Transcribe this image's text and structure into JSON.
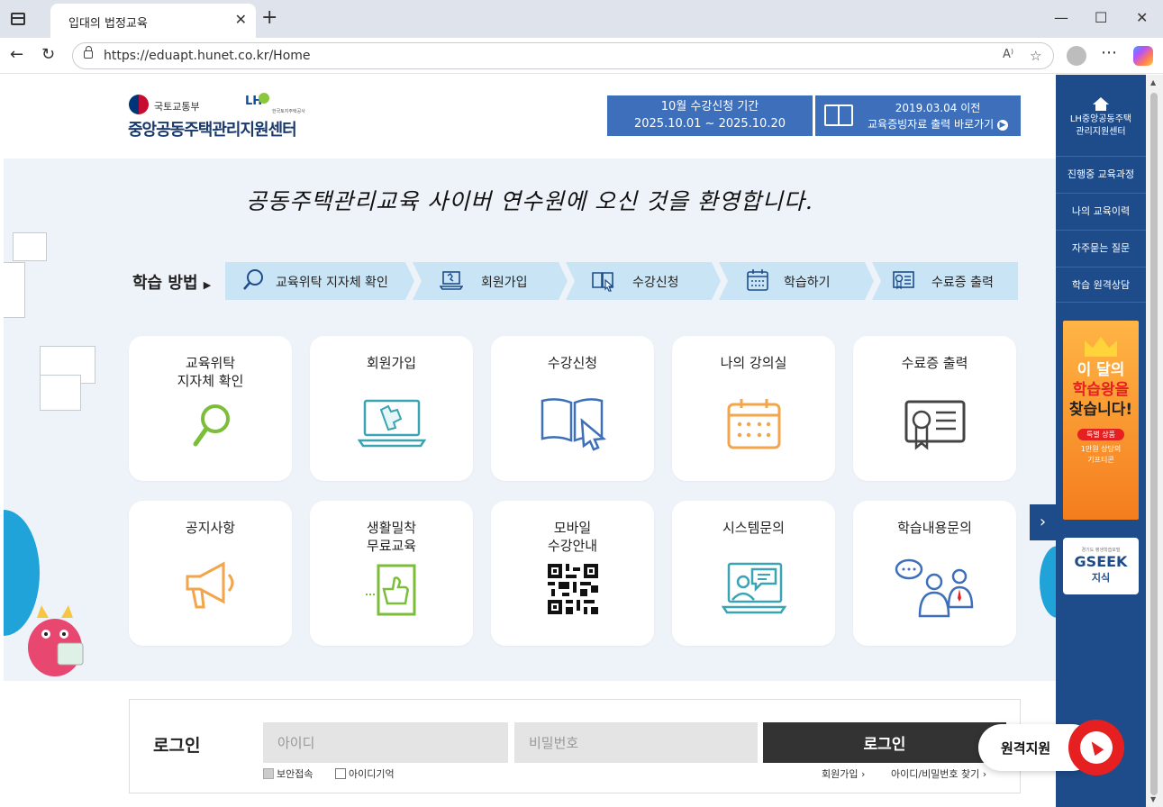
{
  "browser": {
    "tab_title": "입대의 법정교육",
    "url": "https://eduapt.hunet.co.kr/Home"
  },
  "header": {
    "ministry": "국토교통부",
    "lh_logo": "LH",
    "lh_sub": "한국토지주택공사",
    "site_name": "중앙공동주택관리지원센터",
    "banner1_line1": "10월 수강신청 기간",
    "banner1_line2": "2025.10.01 ~ 2025.10.20",
    "banner2_line1": "2019.03.04 이전",
    "banner2_line2": "교육증빙자료 출력 바로가기"
  },
  "hero": {
    "welcome": "공동주택관리교육 사이버 연수원에 오신 것을 환영합니다."
  },
  "steps": {
    "label": "학습 방법",
    "items": [
      {
        "label": "교육위탁 지자체 확인",
        "icon": "search-icon"
      },
      {
        "label": "회원가입",
        "icon": "laptop-puzzle-icon"
      },
      {
        "label": "수강신청",
        "icon": "book-cursor-icon"
      },
      {
        "label": "학습하기",
        "icon": "calendar-icon"
      },
      {
        "label": "수료증 출력",
        "icon": "certificate-icon"
      }
    ]
  },
  "cards": [
    {
      "title": "교육위탁\n지자체 확인",
      "icon": "search-icon"
    },
    {
      "title": "회원가입",
      "icon": "laptop-puzzle-icon"
    },
    {
      "title": "수강신청",
      "icon": "book-cursor-icon"
    },
    {
      "title": "나의 강의실",
      "icon": "calendar-icon"
    },
    {
      "title": "수료증 출력",
      "icon": "certificate-icon"
    },
    {
      "title": "공지사항",
      "icon": "megaphone-icon"
    },
    {
      "title": "생활밀착\n무료교육",
      "icon": "thumbs-up-book-icon"
    },
    {
      "title": "모바일\n수강안내",
      "icon": "qr-code-icon"
    },
    {
      "title": "시스템문의",
      "icon": "video-chat-icon"
    },
    {
      "title": "학습내용문의",
      "icon": "people-chat-icon"
    }
  ],
  "login": {
    "title": "로그인",
    "id_placeholder": "아이디",
    "pw_placeholder": "비밀번호",
    "button": "로그인",
    "secure": "보안접속",
    "remember": "아이디기억",
    "join": "회원가입",
    "find": "아이디/비밀번호 찾기"
  },
  "sidebar": {
    "home_line1": "LH중앙공동주택",
    "home_line2": "관리지원센터",
    "items": [
      "진행중 교육과정",
      "나의 교육이력",
      "자주묻는 질문",
      "학습 원격상담"
    ],
    "promo_line1": "이 달의",
    "promo_line2": "학습왕을",
    "promo_line3": "찾습니다!",
    "promo_pill": "특별 상품",
    "promo_sub1": "1만원 상당의",
    "promo_sub2": "기프티콘",
    "gseek_small": "경기도 평생학습포털",
    "gseek_main": "GSEEK",
    "gseek_sub": "지식"
  },
  "remote": {
    "label": "원격지원"
  },
  "colors": {
    "brand_blue": "#1e4c8a",
    "banner_blue": "#3e6fba",
    "step_bg": "#c9e5f5",
    "hero_bg": "#eef3f9",
    "accent_red": "#e62020"
  }
}
